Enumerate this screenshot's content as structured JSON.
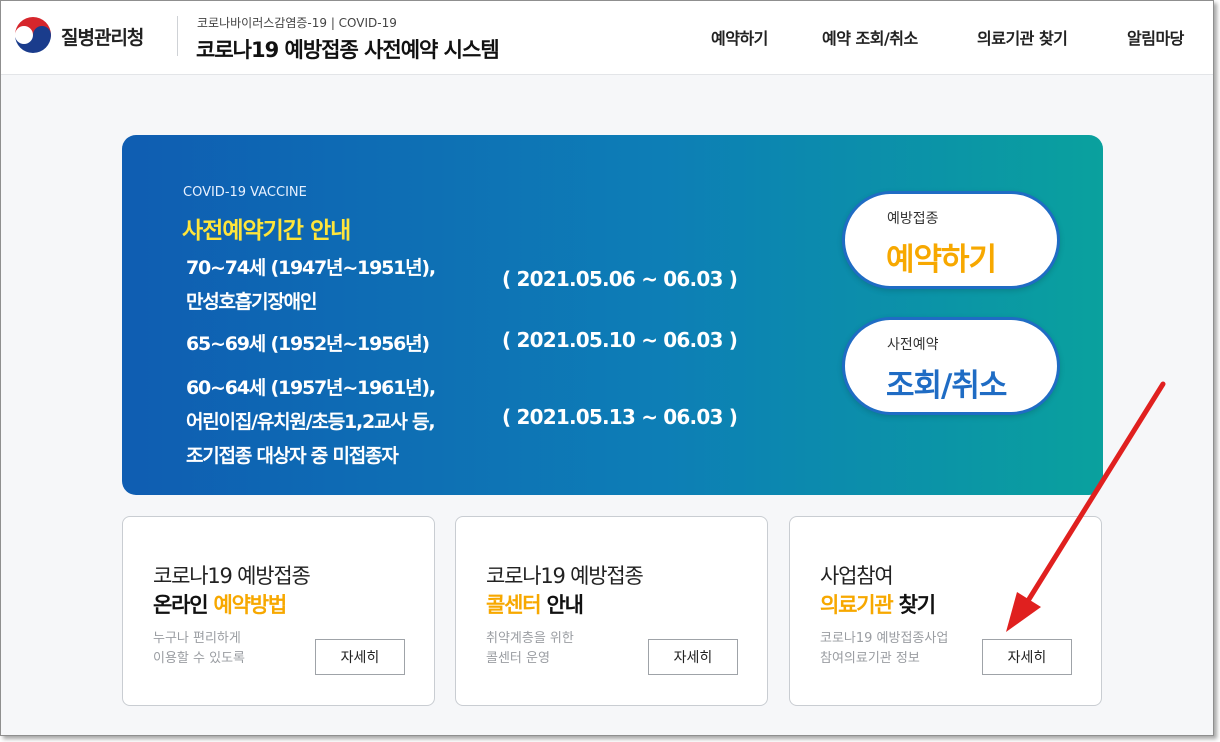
{
  "header": {
    "agency": "질병관리청",
    "sub_title": "코로나바이러스감염증-19 | COVID-19",
    "title": "코로나19 예방접종 사전예약 시스템",
    "nav": [
      "예약하기",
      "예약 조회/취소",
      "의료기관 찾기",
      "알림마당"
    ]
  },
  "banner": {
    "eyebrow": "COVID-19 VACCINE",
    "heading": "사전예약기간 안내",
    "groups": [
      {
        "lines": [
          "70~74세 (1947년~1951년),",
          "만성호흡기장애인"
        ],
        "period": "( 2021.05.06 ~ 06.03 )"
      },
      {
        "lines": [
          "65~69세 (1952년~1956년)"
        ],
        "period": "( 2021.05.10 ~ 06.03 )"
      },
      {
        "lines": [
          "60~64세 (1957년~1961년),",
          "어린이집/유치원/초등1,2교사 등,",
          "조기접종 대상자 중 미접종자"
        ],
        "period": "( 2021.05.13 ~ 06.03 )"
      }
    ],
    "reserve_button": {
      "small": "예방접종",
      "big": "예약하기"
    },
    "lookup_button": {
      "small": "사전예약",
      "big": "조회/취소"
    }
  },
  "cards": [
    {
      "line1": "코로나19 예방접종",
      "line2_a": "온라인 ",
      "line2_b": "예약방법",
      "desc": [
        "누구나 편리하게",
        "이용할 수 있도록"
      ],
      "button": "자세히"
    },
    {
      "line1": "코로나19 예방접종",
      "line2_a": "콜센터",
      "line2_b": " 안내",
      "desc": [
        "취약계층을 위한",
        "콜센터 운영"
      ],
      "button": "자세히"
    },
    {
      "line1": "사업참여",
      "line2_a": "의료기관",
      "line2_b": " 찾기",
      "desc": [
        "코로나19 예방접종사업",
        "참여의료기관 정보"
      ],
      "button": "자세히"
    }
  ],
  "colors": {
    "accent_yellow": "#ffe53a",
    "accent_orange": "#f7a800",
    "brand_blue": "#1f6cc4",
    "arrow_red": "#e0201f"
  }
}
